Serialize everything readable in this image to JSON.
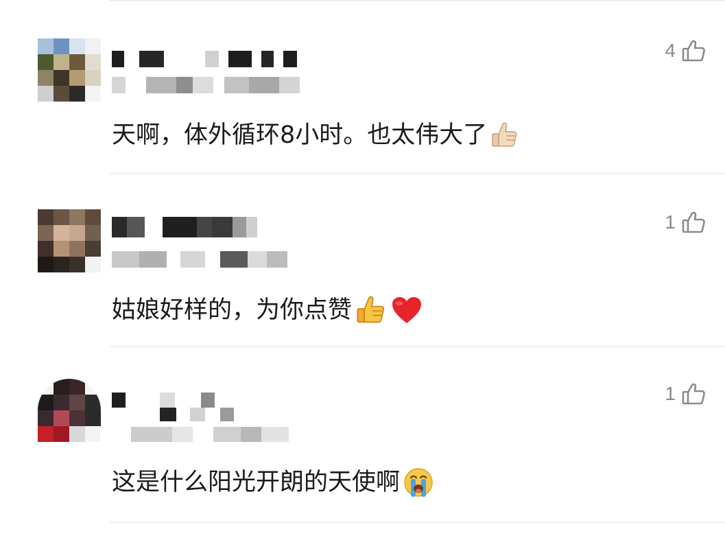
{
  "comments": [
    {
      "like_count": "4",
      "text": "天啊，体外循环8小时。也太伟大了",
      "emoji": "thumbs-up-light"
    },
    {
      "like_count": "1",
      "text": "姑娘好样的，为你点赞",
      "emoji": "thumbs-up-heart"
    },
    {
      "like_count": "1",
      "text": "这是什么阳光开朗的天使啊",
      "emoji": "crying-face"
    }
  ],
  "colors": {
    "text": "#1b1b1b",
    "like_gray": "#8a8a8a",
    "divider": "#efefef",
    "heart": "#e8242b",
    "thumb_yellow": "#f5b83d"
  }
}
